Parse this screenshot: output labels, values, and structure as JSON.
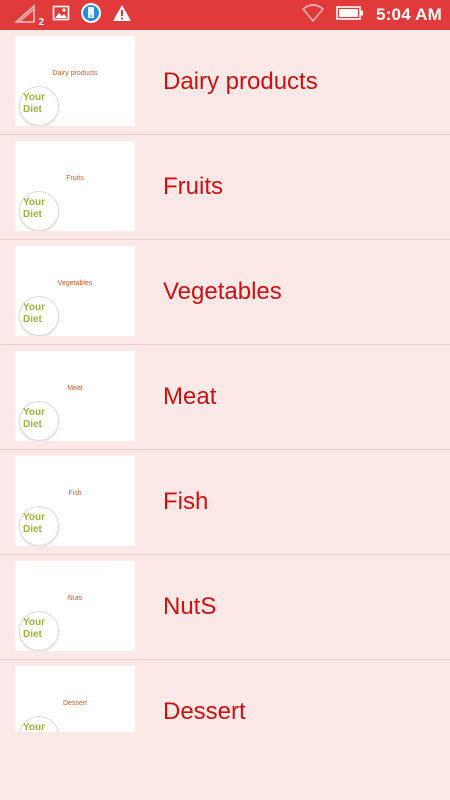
{
  "status_bar": {
    "sim_badge": "2",
    "time": "5:04 AM"
  },
  "categories": [
    {
      "label": "Dairy products",
      "thumb_caption": "Dairy products",
      "logo_top": "Your",
      "logo_bottom": "Diet"
    },
    {
      "label": "Fruits",
      "thumb_caption": "Fruits",
      "logo_top": "Your",
      "logo_bottom": "Diet"
    },
    {
      "label": "Vegetables",
      "thumb_caption": "Vegetables",
      "logo_top": "Your",
      "logo_bottom": "Diet"
    },
    {
      "label": "Meat",
      "thumb_caption": "Meat",
      "logo_top": "Your",
      "logo_bottom": "Diet"
    },
    {
      "label": "Fish",
      "thumb_caption": "Fish",
      "logo_top": "Your",
      "logo_bottom": "Diet"
    },
    {
      "label": "NutS",
      "thumb_caption": "Nuts",
      "logo_top": "Your",
      "logo_bottom": "Diet"
    },
    {
      "label": "Dessert",
      "thumb_caption": "Dessert",
      "logo_top": "Your",
      "logo_bottom": ""
    }
  ],
  "colors": {
    "status_bar": "#e03a3a",
    "background": "#fde8e8",
    "label": "#cc1111"
  }
}
